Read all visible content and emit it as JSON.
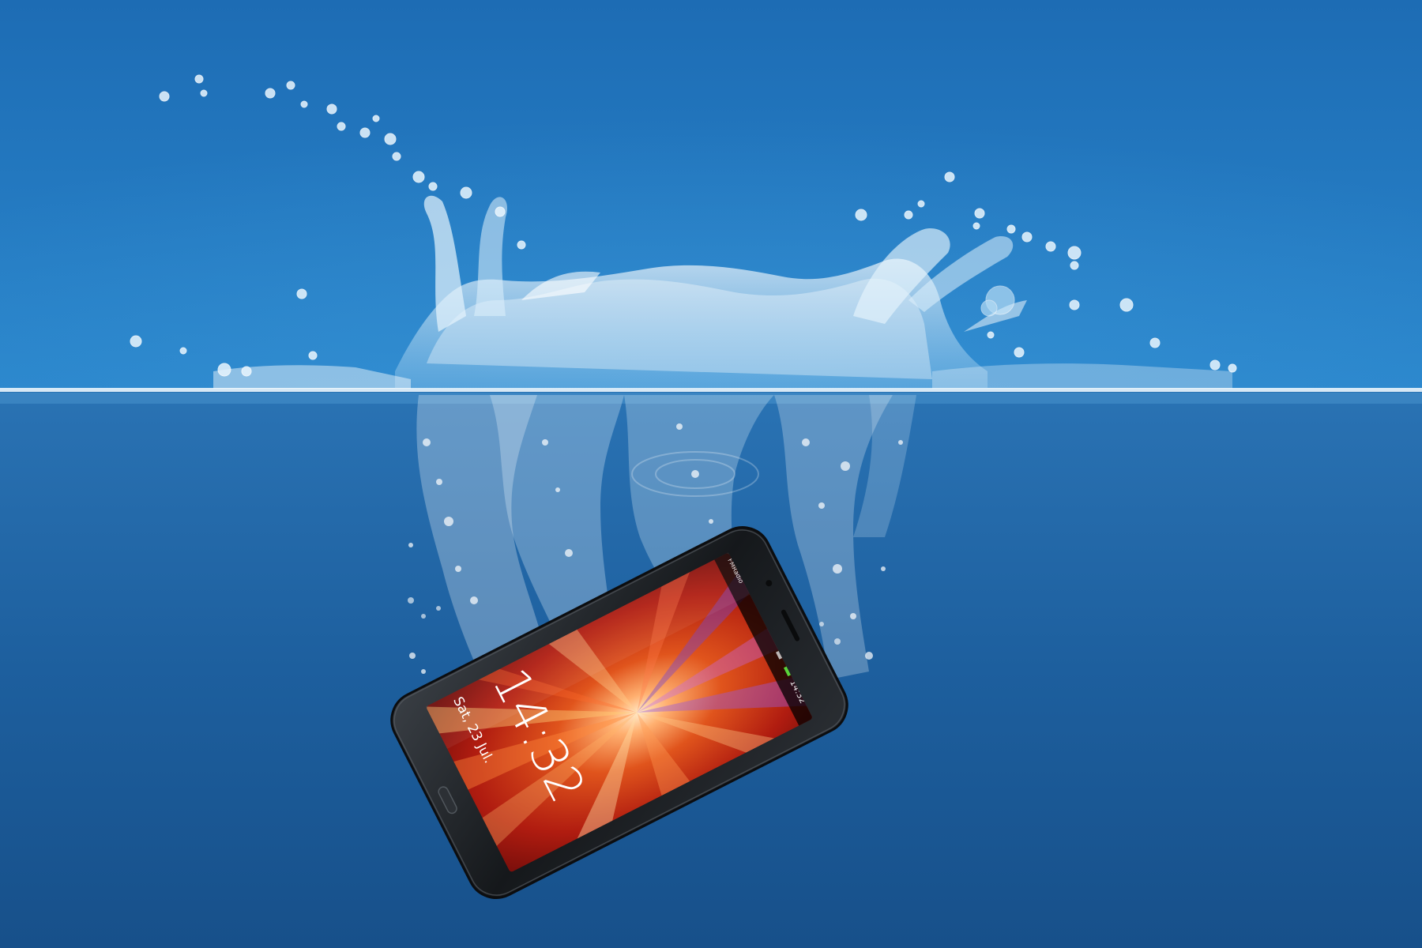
{
  "photo": {
    "colors": {
      "sky": "#1f6fb6",
      "water": "#1b5f9f",
      "surface_line": "#e8f3fb",
      "splash": "#ffffff",
      "phone_body": "#1c1f22",
      "wallpaper_core": "#ffd0a0",
      "wallpaper_red": "#c0260e",
      "wallpaper_violet": "#8a4fd8"
    }
  },
  "phone": {
    "lockscreen": {
      "time": "14:32",
      "date": "Sat, 23 Jul.",
      "status_time": "14:32",
      "notification": "FMRadio"
    }
  }
}
